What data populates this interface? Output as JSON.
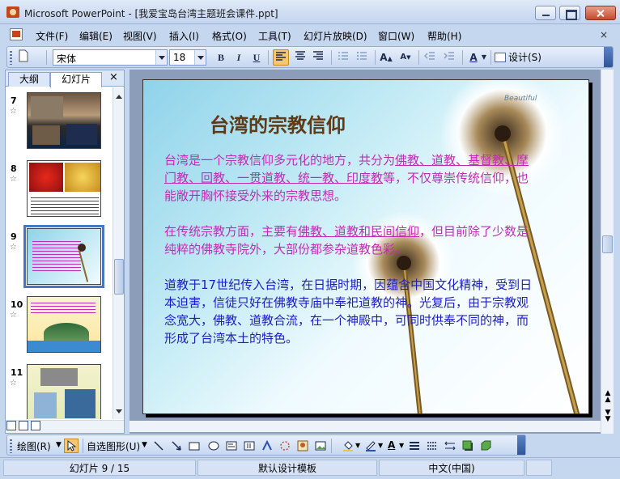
{
  "window": {
    "title": "Microsoft PowerPoint - [我爱宝岛台湾主题班会课件.ppt]"
  },
  "menubar": {
    "items": [
      "文件(F)",
      "编辑(E)",
      "视图(V)",
      "插入(I)",
      "格式(O)",
      "工具(T)",
      "幻灯片放映(D)",
      "窗口(W)",
      "帮助(H)"
    ],
    "close_doc": "×"
  },
  "toolbar": {
    "font_name": "宋体",
    "font_size": "18",
    "bold": "B",
    "italic": "I",
    "underline": "U",
    "font_color_label": "A",
    "design_label": "设计(S)"
  },
  "left_panel": {
    "tabs": [
      "大纲",
      "幻灯片"
    ],
    "close_label": "×",
    "slides": [
      {
        "num": "7"
      },
      {
        "num": "8"
      },
      {
        "num": "9",
        "selected": true
      },
      {
        "num": "10"
      },
      {
        "num": "11"
      }
    ],
    "star": "☆"
  },
  "slide": {
    "title": "台湾的宗教信仰",
    "deco_text": "Beautiful",
    "para1_a": "台湾是一个宗教信仰多元化的地方，共分为",
    "para1_b": "佛教、道教、基督教、摩门教、回教、一贯道教、统一教、印度教",
    "para1_c": "等，不仅尊崇传统信仰，也能敞开胸怀接受外来的宗教思想。",
    "para2_a": "在传统宗教方面，主要有",
    "para2_b": "佛教、道教和民间信仰",
    "para2_c": "，但目前除了少数是纯粹的佛教寺院外，大部份都参杂道教色彩。",
    "para3": "道教于17世纪传入台湾，在日据时期，因蕴含中国文化精神，受到日本迫害，信徒只好在佛教寺庙中奉祀道教的神。光复后，由于宗教观念宽大，佛教、道教合流，在一个神殿中，可同时供奉不同的神，而形成了台湾本土的特色。"
  },
  "drawbar": {
    "draw_label": "绘图(R)",
    "autoshape_label": "自选图形(U)"
  },
  "statusbar": {
    "slide_info": "幻灯片 9 / 15",
    "template": "默认设计模板",
    "language": "中文(中国)"
  }
}
